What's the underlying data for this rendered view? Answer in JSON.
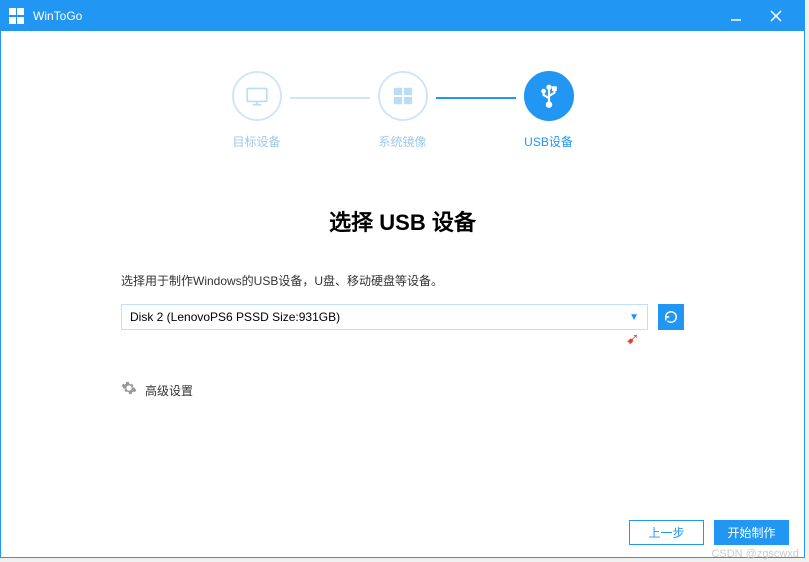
{
  "titlebar": {
    "app_name": "WinToGo"
  },
  "wizard": {
    "step1_label": "目标设备",
    "step2_label": "系统镜像",
    "step3_label": "USB设备"
  },
  "main": {
    "title_prefix": "选择 ",
    "title_bold": "USB",
    "title_suffix": " 设备",
    "description": "选择用于制作Windows的USB设备，U盘、移动硬盘等设备。",
    "selected_device": "Disk 2 (LenovoPS6 PSSD Size:931GB)",
    "advanced_label": "高级设置"
  },
  "footer": {
    "prev_label": "上一步",
    "start_label": "开始制作"
  },
  "watermark": "CSDN @zgscwxd"
}
